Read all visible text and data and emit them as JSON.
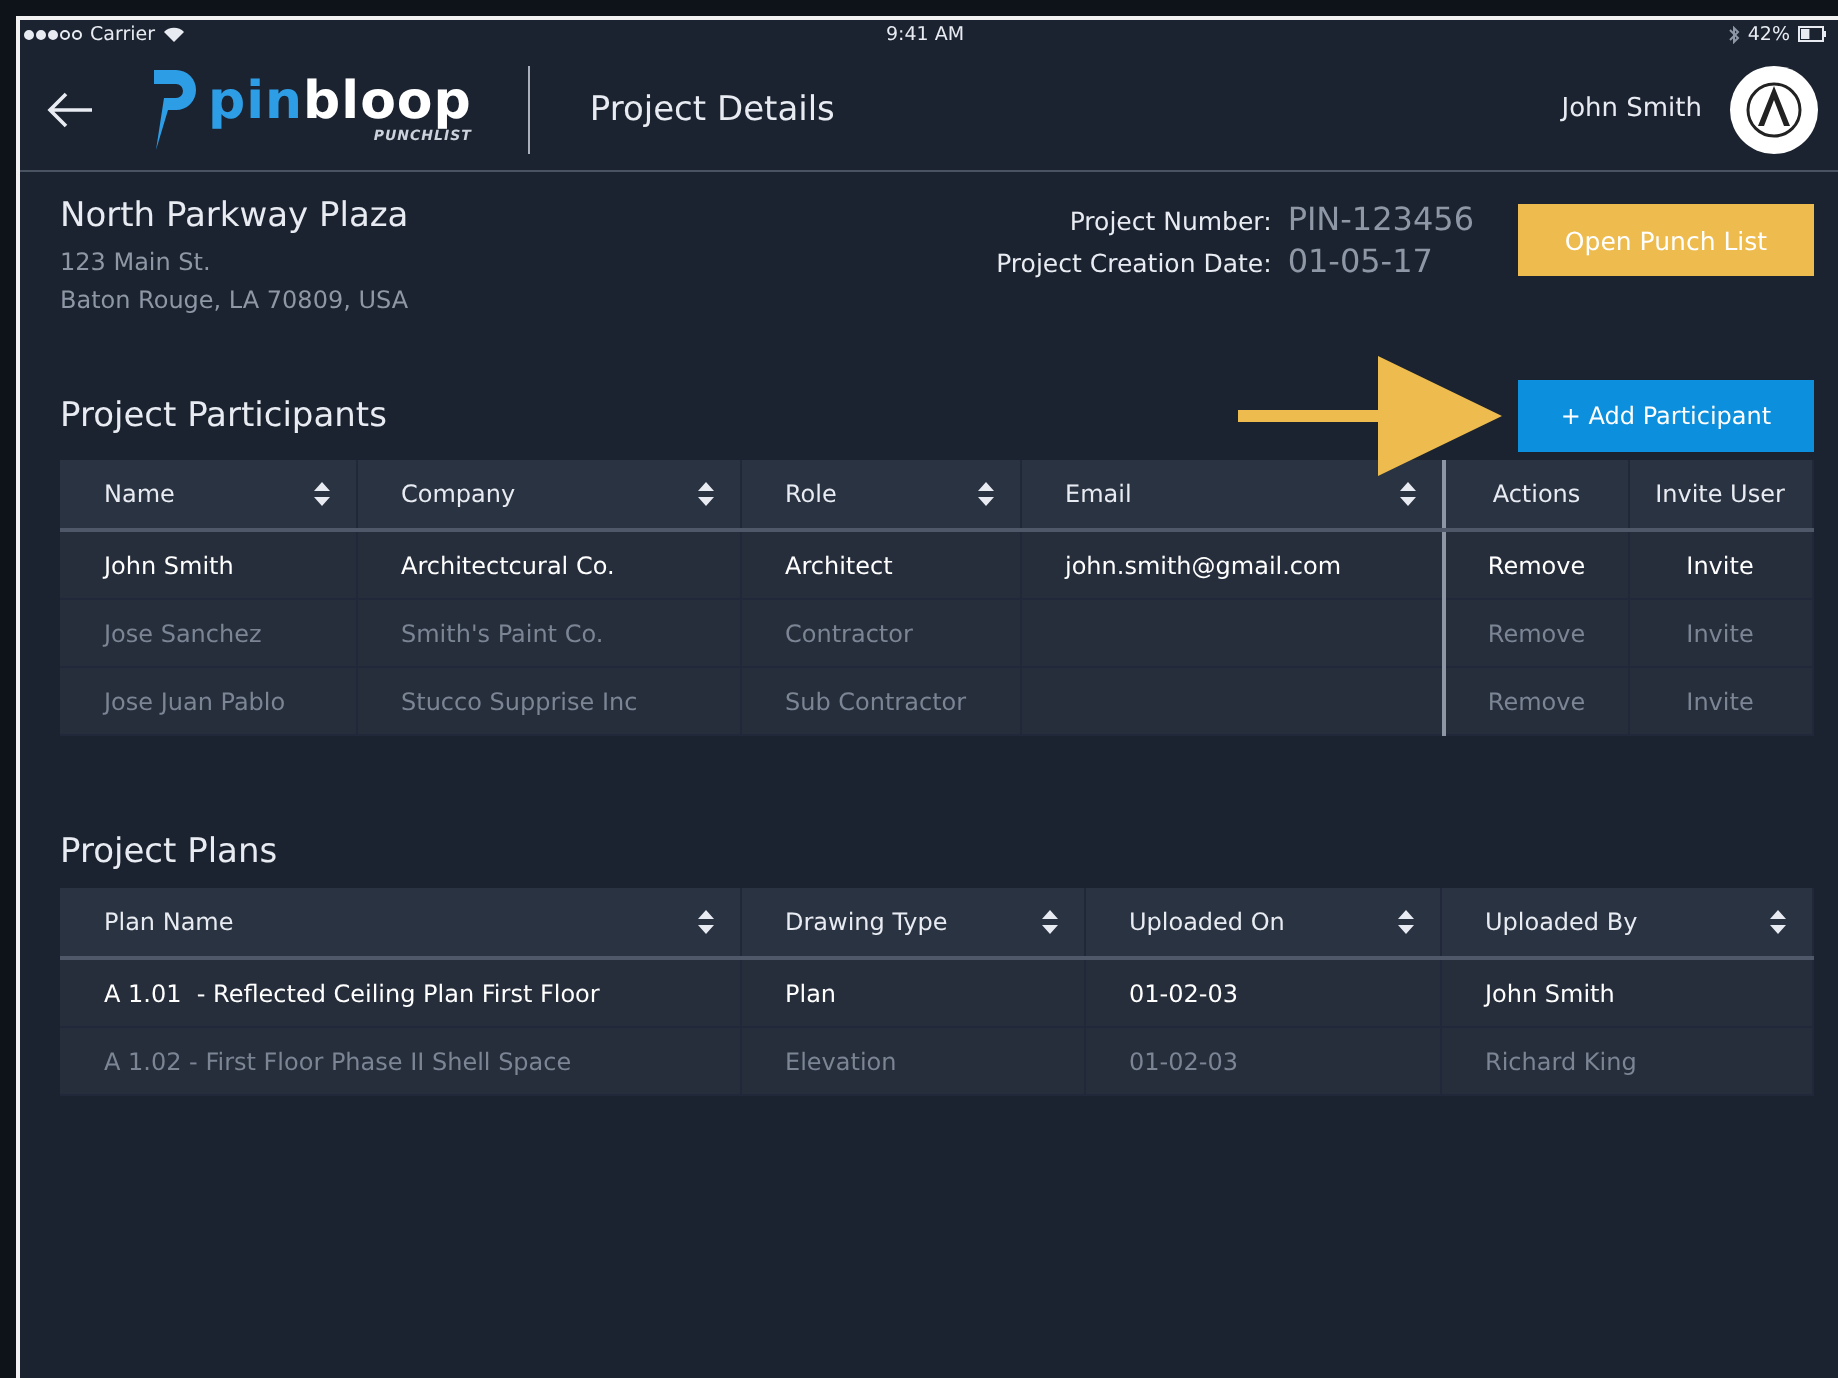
{
  "status_bar": {
    "carrier": "Carrier",
    "time": "9:41 AM",
    "battery": "42%"
  },
  "header": {
    "logo": {
      "accent": "pin",
      "rest": "bloop",
      "tagline": "PUNCHLIST"
    },
    "title": "Project Details",
    "user": "John Smith"
  },
  "project": {
    "name": "North Parkway Plaza",
    "address": [
      "123 Main St.",
      "Baton Rouge, LA 70809, USA"
    ],
    "fields": [
      {
        "label": "Project Number:",
        "value": "PIN-123456"
      },
      {
        "label": "Project Creation Date:",
        "value": "01-05-17"
      }
    ],
    "button": "Open Punch List"
  },
  "participants": {
    "title": "Project Participants",
    "button": "+ Add Participant",
    "columns": [
      {
        "label": "Name",
        "sortable": true
      },
      {
        "label": "Company",
        "sortable": true
      },
      {
        "label": "Role",
        "sortable": true
      },
      {
        "label": "Email",
        "sortable": true
      },
      {
        "label": "Actions",
        "sortable": false
      },
      {
        "label": "Invite User",
        "sortable": false
      }
    ],
    "rows": [
      {
        "active": true,
        "cells": [
          "John Smith",
          "Architectcural Co.",
          "Architect",
          "john.smith@gmail.com"
        ],
        "actions": [
          "Remove",
          "Invite"
        ]
      },
      {
        "active": false,
        "cells": [
          "Jose Sanchez",
          "Smith's Paint Co.",
          "Contractor",
          ""
        ],
        "actions": [
          "Remove",
          "Invite"
        ]
      },
      {
        "active": false,
        "cells": [
          "Jose Juan Pablo",
          "Stucco Supprise Inc",
          "Sub Contractor",
          ""
        ],
        "actions": [
          "Remove",
          "Invite"
        ]
      }
    ]
  },
  "plans": {
    "title": "Project Plans",
    "columns": [
      {
        "label": "Plan Name",
        "sortable": true
      },
      {
        "label": "Drawing Type",
        "sortable": true
      },
      {
        "label": "Uploaded On",
        "sortable": true
      },
      {
        "label": "Uploaded By",
        "sortable": true
      }
    ],
    "rows": [
      {
        "active": true,
        "cells": [
          "A 1.01  - Reflected Ceiling Plan First Floor",
          "Plan",
          "01-02-03",
          "John Smith"
        ]
      },
      {
        "active": false,
        "cells": [
          "A 1.02 - First Floor Phase II Shell Space",
          "Elevation",
          "01-02-03",
          "Richard King"
        ]
      }
    ]
  }
}
